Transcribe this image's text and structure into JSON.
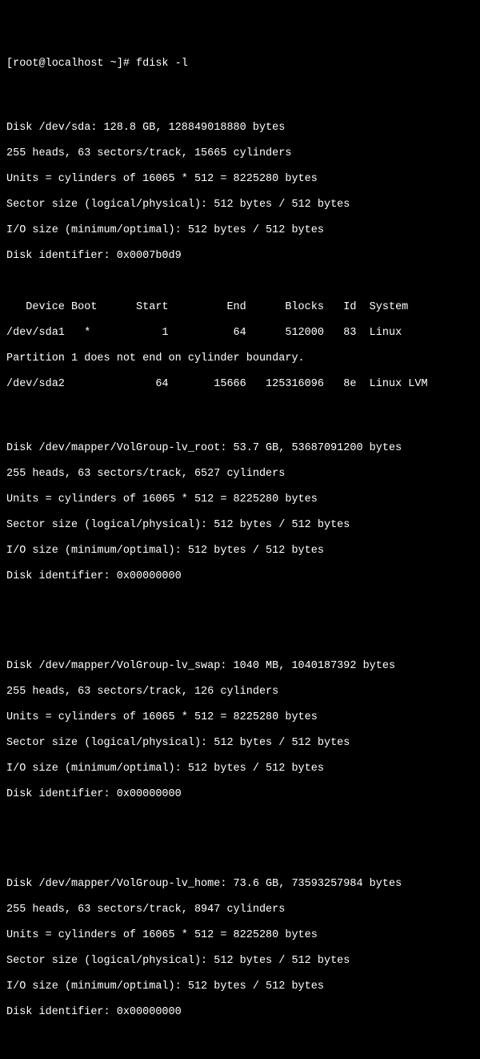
{
  "prompt": "[root@localhost ~]# fdisk -l",
  "disks": [
    {
      "disk_line": "Disk /dev/sda: 128.8 GB, 128849018880 bytes",
      "geometry": "255 heads, 63 sectors/track, 15665 cylinders",
      "units": "Units = cylinders of 16065 * 512 = 8225280 bytes",
      "sector_size": "Sector size (logical/physical): 512 bytes / 512 bytes",
      "io_size": "I/O size (minimum/optimal): 512 bytes / 512 bytes",
      "identifier": "Disk identifier: 0x0007b0d9",
      "part_header": "   Device Boot      Start         End      Blocks   Id  System",
      "partitions": [
        "/dev/sda1   *           1          64      512000   83  Linux",
        "Partition 1 does not end on cylinder boundary.",
        "/dev/sda2              64       15666   125316096   8e  Linux LVM"
      ]
    },
    {
      "disk_line": "Disk /dev/mapper/VolGroup-lv_root: 53.7 GB, 53687091200 bytes",
      "geometry": "255 heads, 63 sectors/track, 6527 cylinders",
      "units": "Units = cylinders of 16065 * 512 = 8225280 bytes",
      "sector_size": "Sector size (logical/physical): 512 bytes / 512 bytes",
      "io_size": "I/O size (minimum/optimal): 512 bytes / 512 bytes",
      "identifier": "Disk identifier: 0x00000000"
    },
    {
      "disk_line": "Disk /dev/mapper/VolGroup-lv_swap: 1040 MB, 1040187392 bytes",
      "geometry": "255 heads, 63 sectors/track, 126 cylinders",
      "units": "Units = cylinders of 16065 * 512 = 8225280 bytes",
      "sector_size": "Sector size (logical/physical): 512 bytes / 512 bytes",
      "io_size": "I/O size (minimum/optimal): 512 bytes / 512 bytes",
      "identifier": "Disk identifier: 0x00000000"
    },
    {
      "disk_line": "Disk /dev/mapper/VolGroup-lv_home: 73.6 GB, 73593257984 bytes",
      "geometry": "255 heads, 63 sectors/track, 8947 cylinders",
      "units": "Units = cylinders of 16065 * 512 = 8225280 bytes",
      "sector_size": "Sector size (logical/physical): 512 bytes / 512 bytes",
      "io_size": "I/O size (minimum/optimal): 512 bytes / 512 bytes",
      "identifier": "Disk identifier: 0x00000000"
    }
  ]
}
